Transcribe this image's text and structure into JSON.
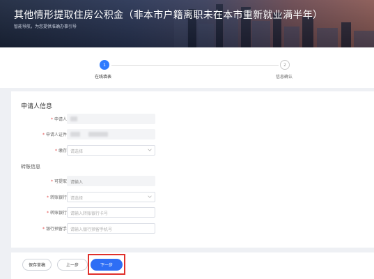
{
  "banner": {
    "title": "其他情形提取住房公积金（非本市户籍离职未在本市重新就业满半年）",
    "subtitle": "智能导航，为您提供准确办事引导"
  },
  "steps": [
    {
      "number": "1",
      "label": "在线填表",
      "state": "active"
    },
    {
      "number": "2",
      "label": "信息确认",
      "state": "inactive"
    }
  ],
  "section_applicant": {
    "title": "申请人信息",
    "fields": [
      {
        "label": "申请人姓名",
        "required": true,
        "value": "",
        "obscured": true
      },
      {
        "label": "申请人证件号码",
        "required": true,
        "value": "",
        "obscured": true
      },
      {
        "label": "缴存中心",
        "required": true,
        "placeholder": "请选择",
        "type": "select"
      }
    ]
  },
  "section_transfer": {
    "title": "转账信息",
    "fields": [
      {
        "label": "可提取金额",
        "required": true,
        "value": "请输入",
        "type": "readonly"
      },
      {
        "label": "转账银行名称",
        "required": true,
        "placeholder": "请选择",
        "type": "select"
      },
      {
        "label": "转账银行卡号",
        "required": true,
        "placeholder": "请输入转账银行卡号",
        "type": "input"
      },
      {
        "label": "银行预留手机号",
        "required": true,
        "placeholder": "请输入银行预留手机号",
        "type": "input"
      }
    ]
  },
  "footer": {
    "save_label": "保存草稿",
    "prev_label": "上一步",
    "next_label": "下一步"
  },
  "colors": {
    "accent": "#2e7bff",
    "highlight_border": "#e0302b",
    "required_mark": "#e24a4a"
  }
}
